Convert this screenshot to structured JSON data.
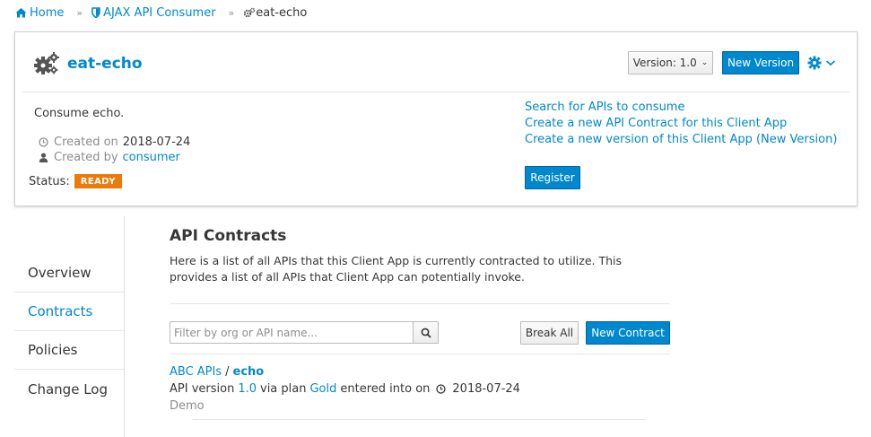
{
  "breadcrumb": {
    "home": "Home",
    "app": "AJAX API Consumer",
    "current": "eat-echo",
    "separator": "»"
  },
  "header": {
    "title": "eat-echo",
    "version_label": "Version: 1.0",
    "new_version_label": "New Version",
    "description": "Consume echo.",
    "created_on_label": "Created on",
    "created_on_value": "2018-07-24",
    "created_by_label": "Created by",
    "created_by_value": "consumer",
    "status_label": "Status:",
    "status_value": "READY",
    "links": [
      "Search for APIs to consume",
      "Create a new API Contract for this Client App",
      "Create a new version of this Client App (New Version)"
    ],
    "register_label": "Register"
  },
  "nav": {
    "items": [
      "Overview",
      "Contracts",
      "Policies",
      "Change Log"
    ],
    "active": "Contracts"
  },
  "main": {
    "title": "API Contracts",
    "description": "Here is a list of all APIs that this Client App is currently contracted to utilize. This provides a list of all APIs that Client App can potentially invoke.",
    "filter_placeholder": "Filter by org or API name...",
    "break_all_label": "Break All",
    "new_contract_label": "New Contract",
    "contracts": [
      {
        "org": "ABC APIs",
        "slash": "/",
        "api": "echo",
        "version_prefix": "API version",
        "version": "1.0",
        "plan_prefix": "via plan",
        "plan": "Gold",
        "date_prefix": "entered into on",
        "date": "2018-07-24",
        "note": "Demo"
      }
    ]
  },
  "colors": {
    "accent": "#0088ce",
    "status_ready": "#ec7a08"
  },
  "icons": [
    "home-icon",
    "shield-icon",
    "gears-icon",
    "gear-icon",
    "chevron-down-icon",
    "clock-icon",
    "user-icon",
    "search-icon"
  ]
}
